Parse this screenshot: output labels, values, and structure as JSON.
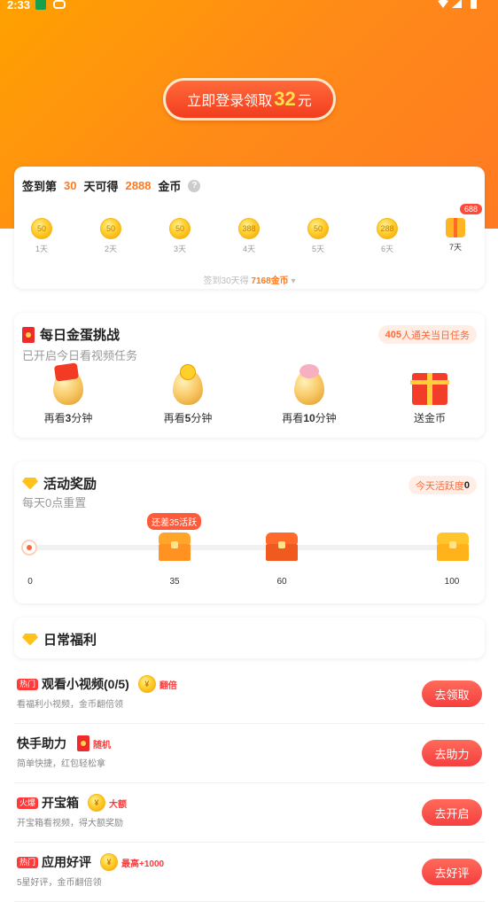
{
  "status_bar": {
    "time": "2:33"
  },
  "hero": {
    "login_prefix": "立即登录领取",
    "login_amount": "32",
    "login_suffix": "元"
  },
  "checkin": {
    "prefix": "签到第",
    "day_count": "30",
    "mid": "天可得",
    "coins": "2888",
    "suffix": "金币",
    "days": [
      {
        "value": "50",
        "label": "1天"
      },
      {
        "value": "50",
        "label": "2天"
      },
      {
        "value": "50",
        "label": "3天"
      },
      {
        "value": "388",
        "label": "4天"
      },
      {
        "value": "50",
        "label": "5天"
      },
      {
        "value": "288",
        "label": "6天"
      },
      {
        "value": "688",
        "label": "7天"
      }
    ],
    "total_prefix": "签到30天得",
    "total_value": "7168金币"
  },
  "egg_challenge": {
    "title": "每日金蛋挑战",
    "subtitle": "已开启今日看视频任务",
    "pill_count": "405",
    "pill_text": "人通关当日任务",
    "items": [
      {
        "pre": "再看",
        "num": "3",
        "post": "分钟"
      },
      {
        "pre": "再看",
        "num": "5",
        "post": "分钟"
      },
      {
        "pre": "再看",
        "num": "10",
        "post": "分钟"
      },
      {
        "pre": "送金币",
        "num": "",
        "post": ""
      }
    ]
  },
  "activity": {
    "title": "活动奖励",
    "subtitle": "每天0点重置",
    "pill_text": "今天活跃度",
    "pill_value": "0",
    "remain_tip": "还差35活跃",
    "ticks": [
      "0",
      "35",
      "60",
      "100"
    ],
    "progress": 0
  },
  "daily": {
    "title": "日常福利",
    "rows": [
      {
        "tag": "热门",
        "title": "观看小视频(0/5)",
        "reward_icon": "coin",
        "reward": "翻倍",
        "desc": "看福利小视频，金币翻倍领",
        "button": "去领取"
      },
      {
        "tag": "",
        "title": "快手助力",
        "reward_icon": "envelope",
        "reward": "随机",
        "desc": "简单快捷，红包轻松拿",
        "button": "去助力"
      },
      {
        "tag": "火爆",
        "title": "开宝箱",
        "reward_icon": "coin",
        "reward": "大额",
        "desc": "开宝箱看视频，得大额奖励",
        "button": "去开启"
      },
      {
        "tag": "热门",
        "title": "应用好评",
        "reward_icon": "coin",
        "reward": "最高+1000",
        "desc": "5星好评，金币翻倍领",
        "button": "去好评"
      }
    ]
  }
}
